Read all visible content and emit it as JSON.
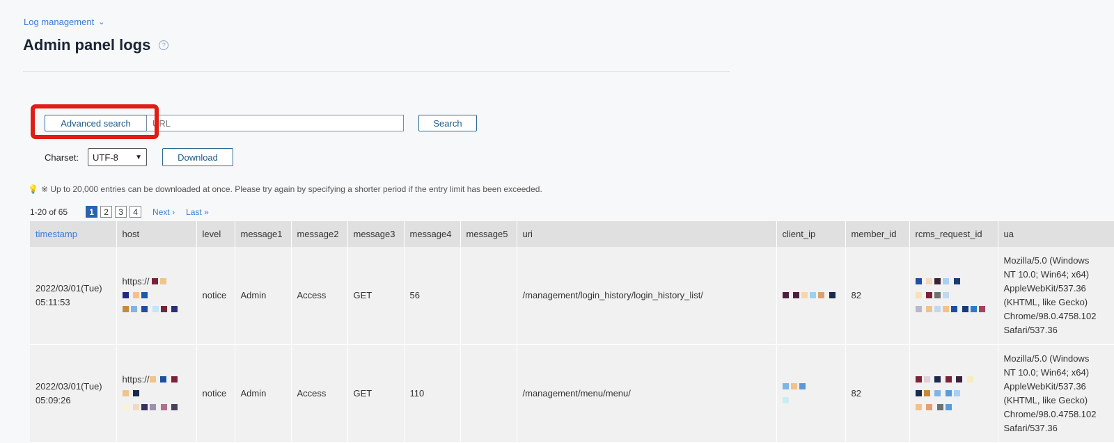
{
  "breadcrumb": {
    "label": "Log management"
  },
  "page": {
    "title": "Admin panel logs"
  },
  "search": {
    "advanced_label": "Advanced search",
    "url_placeholder": "URL",
    "search_label": "Search"
  },
  "charset": {
    "label": "Charset:",
    "selected": "UTF-8"
  },
  "download": {
    "label": "Download"
  },
  "notice": {
    "text": "※ Up to 20,000 entries can be downloaded at once. Please try again by specifying a shorter period if the entry limit has been exceeded."
  },
  "pager": {
    "count": "1-20 of 65",
    "pages": [
      "1",
      "2",
      "3",
      "4"
    ],
    "next": "Next",
    "last": "Last"
  },
  "table": {
    "columns": [
      "timestamp",
      "host",
      "level",
      "message1",
      "message2",
      "message3",
      "message4",
      "message5",
      "uri",
      "client_ip",
      "member_id",
      "rcms_request_id",
      "ua"
    ],
    "rows": [
      {
        "timestamp_date": "2022/03/01(Tue)",
        "timestamp_time": "05:11:53",
        "host": "https://",
        "level": "notice",
        "message1": "Admin",
        "message2": "Access",
        "message3": "GET",
        "message4": "56",
        "message5": "",
        "uri": "/management/login_history/login_history_list/",
        "member_id": "82",
        "ua": [
          "Mozilla/5.0 (Windows",
          "NT 10.0; Win64; x64)",
          "AppleWebKit/537.36",
          "(KHTML, like Gecko)",
          "Chrome/98.0.4758.102",
          "Safari/537.36"
        ]
      },
      {
        "timestamp_date": "2022/03/01(Tue)",
        "timestamp_time": "05:09:26",
        "host": "https://",
        "level": "notice",
        "message1": "Admin",
        "message2": "Access",
        "message3": "GET",
        "message4": "110",
        "message5": "",
        "uri": "/management/menu/menu/",
        "member_id": "82",
        "ua": [
          "Mozilla/5.0 (Windows",
          "NT 10.0; Win64; x64)",
          "AppleWebKit/537.36",
          "(KHTML, like Gecko)",
          "Chrome/98.0.4758.102",
          "Safari/537.36"
        ]
      }
    ]
  },
  "colors": {
    "accent": "#3a7bd5",
    "highlight": "#e01c14",
    "button_text": "#1e5a84"
  }
}
